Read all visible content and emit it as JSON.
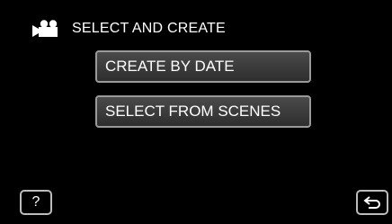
{
  "header": {
    "icon": "video-camera-icon",
    "title": "SELECT AND CREATE"
  },
  "menu": {
    "items": [
      {
        "label": "CREATE BY DATE"
      },
      {
        "label": "SELECT FROM SCENES"
      }
    ]
  },
  "footer": {
    "help_label": "?",
    "help_icon": "question-mark-icon",
    "back_icon": "return-arrow-icon"
  },
  "colors": {
    "background": "#000000",
    "text": "#ffffff",
    "button_border": "#9a9a9a"
  }
}
